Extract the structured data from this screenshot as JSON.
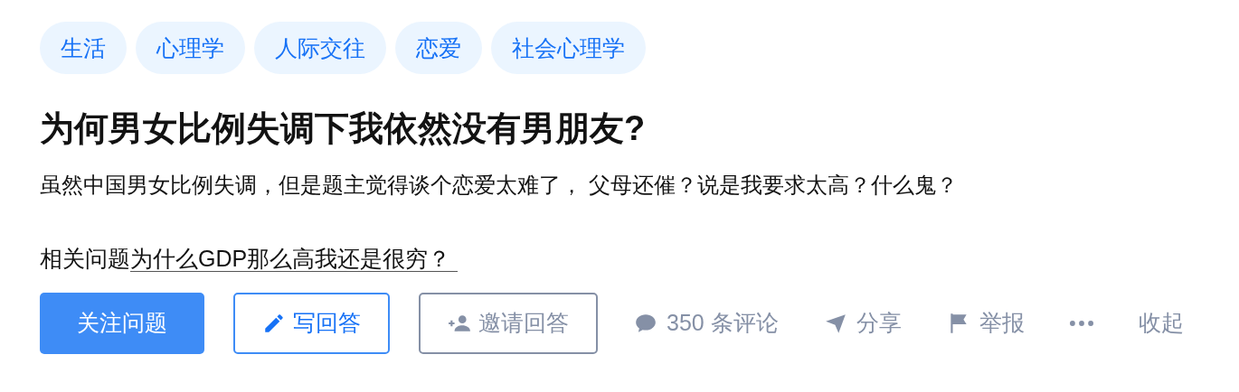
{
  "tags": [
    {
      "label": "生活"
    },
    {
      "label": "心理学"
    },
    {
      "label": "人际交往"
    },
    {
      "label": "恋爱"
    },
    {
      "label": "社会心理学"
    }
  ],
  "title": "为何男女比例失调下我依然没有男朋友?",
  "description": "虽然中国男女比例失调，但是题主觉得谈个恋爱太难了， 父母还催？说是我要求太高？什么鬼？",
  "related": {
    "label": "相关问题",
    "link": "为什么GDP那么高我还是很穷？"
  },
  "buttons": [
    {
      "label": "关注问题",
      "kind": "primary"
    },
    {
      "label": "写回答",
      "kind": "write"
    },
    {
      "label": "邀请回答",
      "kind": "invite"
    }
  ],
  "actions": [
    {
      "label": "350 条评论",
      "kind": "comment"
    },
    {
      "label": "分享",
      "kind": "share"
    },
    {
      "label": "举报",
      "kind": "report"
    },
    {
      "kind": "more"
    },
    {
      "label": "收起",
      "kind": "collapse"
    }
  ]
}
